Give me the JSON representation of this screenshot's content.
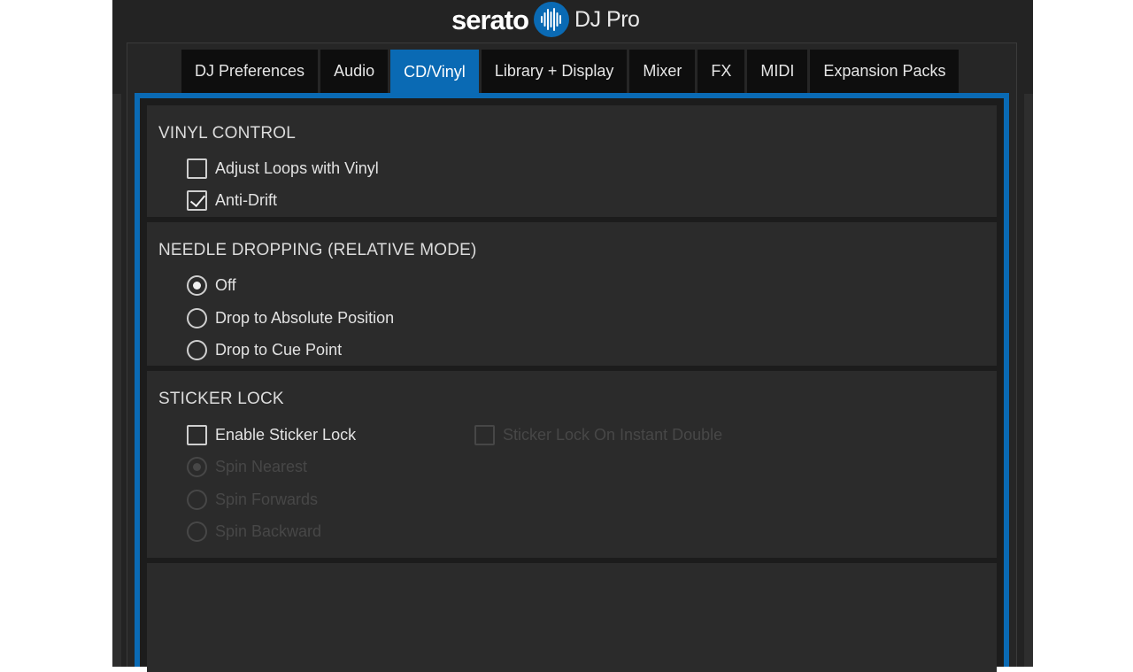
{
  "header": {
    "brand": "serato",
    "product": "DJ Pro"
  },
  "tabs": [
    {
      "label": "DJ Preferences",
      "active": false
    },
    {
      "label": "Audio",
      "active": false
    },
    {
      "label": "CD/Vinyl",
      "active": true
    },
    {
      "label": "Library + Display",
      "active": false
    },
    {
      "label": "Mixer",
      "active": false
    },
    {
      "label": "FX",
      "active": false
    },
    {
      "label": "MIDI",
      "active": false
    },
    {
      "label": "Expansion Packs",
      "active": false
    }
  ],
  "vinyl_control": {
    "title": "VINYL CONTROL",
    "adjust_loops": {
      "label": "Adjust Loops with Vinyl",
      "checked": false
    },
    "anti_drift": {
      "label": "Anti-Drift",
      "checked": true
    }
  },
  "needle_dropping": {
    "title": "NEEDLE DROPPING (RELATIVE MODE)",
    "options": [
      {
        "label": "Off",
        "selected": true
      },
      {
        "label": "Drop to Absolute Position",
        "selected": false
      },
      {
        "label": "Drop to Cue Point",
        "selected": false
      }
    ]
  },
  "sticker_lock": {
    "title": "STICKER LOCK",
    "enable": {
      "label": "Enable Sticker Lock",
      "checked": false
    },
    "instant_double": {
      "label": "Sticker Lock On Instant Double",
      "checked": false,
      "disabled": true
    },
    "spin_options": [
      {
        "label": "Spin Nearest",
        "selected": true,
        "disabled": true
      },
      {
        "label": "Spin Forwards",
        "selected": false,
        "disabled": true
      },
      {
        "label": "Spin Backward",
        "selected": false,
        "disabled": true
      }
    ]
  },
  "colors": {
    "accent": "#0a6ab4",
    "background": "#232323",
    "section": "#2b2b2b"
  }
}
